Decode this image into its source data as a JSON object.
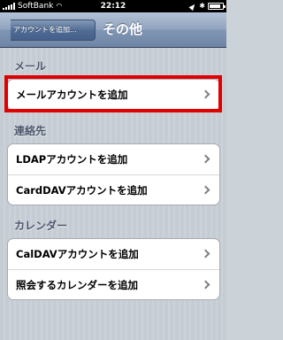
{
  "status_bar": {
    "carrier": "SoftBank",
    "time": "22:12",
    "battery_level": 0.85
  },
  "nav": {
    "back_label": "アカウントを追加...",
    "title": "その他"
  },
  "sections": [
    {
      "header": "メール",
      "rows": [
        "メールアカウントを追加"
      ]
    },
    {
      "header": "連絡先",
      "rows": [
        "LDAPアカウントを追加",
        "CardDAVアカウントを追加"
      ]
    },
    {
      "header": "カレンダー",
      "rows": [
        "CalDAVアカウントを追加",
        "照会するカレンダーを追加"
      ]
    }
  ],
  "colors": {
    "highlight": "#e00000",
    "nav_bar": "#6e85a5"
  },
  "icons": {
    "wifi": "wifi-icon",
    "location": "location-arrow-icon",
    "bluetooth": "bluetooth-icon",
    "battery": "battery-icon",
    "chevron": "chevron-right-icon"
  }
}
